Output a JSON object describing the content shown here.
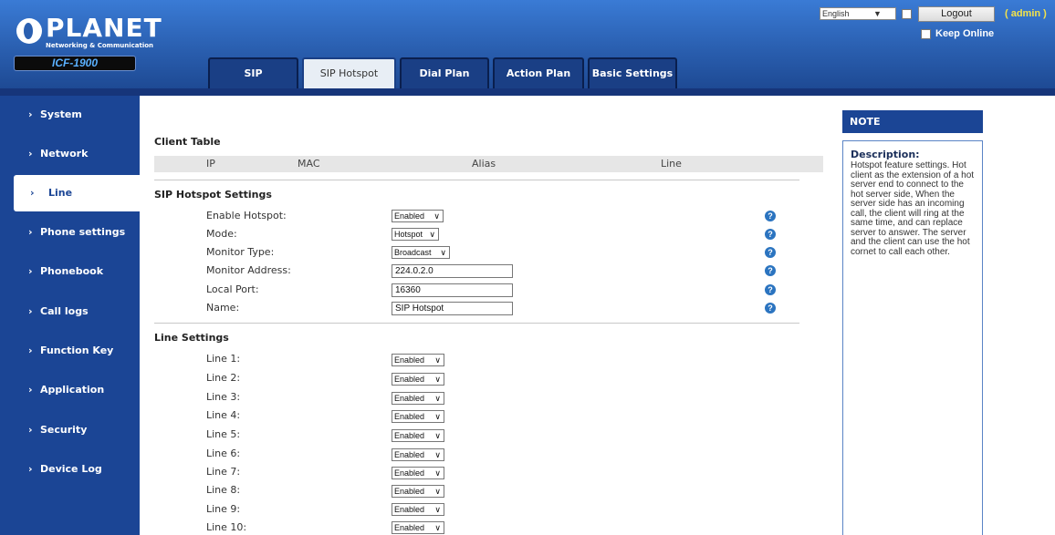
{
  "header": {
    "brand": "PLANET",
    "brand_sub": "Networking & Communication",
    "model": "ICF-1900",
    "language": "English",
    "logout_label": "Logout",
    "user_label": "( admin )",
    "keep_online_label": "Keep Online"
  },
  "tabs": [
    {
      "label": "SIP",
      "active": false
    },
    {
      "label": "SIP Hotspot",
      "active": true
    },
    {
      "label": "Dial Plan",
      "active": false
    },
    {
      "label": "Action Plan",
      "active": false
    },
    {
      "label": "Basic Settings",
      "active": false
    }
  ],
  "sidebar": {
    "items": [
      {
        "label": "System"
      },
      {
        "label": "Network"
      },
      {
        "label": "Line",
        "active": true
      },
      {
        "label": "Phone settings"
      },
      {
        "label": "Phonebook"
      },
      {
        "label": "Call logs"
      },
      {
        "label": "Function Key"
      },
      {
        "label": "Application"
      },
      {
        "label": "Security"
      },
      {
        "label": "Device Log"
      }
    ]
  },
  "client_table": {
    "title": "Client Table",
    "columns": [
      "IP",
      "MAC",
      "Alias",
      "Line"
    ]
  },
  "hotspot": {
    "title": "SIP Hotspot Settings",
    "fields": [
      {
        "label": "Enable Hotspot:",
        "type": "select",
        "value": "Enabled"
      },
      {
        "label": "Mode:",
        "type": "select",
        "value": "Hotspot"
      },
      {
        "label": "Monitor Type:",
        "type": "select",
        "value": "Broadcast"
      },
      {
        "label": "Monitor Address:",
        "type": "text",
        "value": "224.0.2.0"
      },
      {
        "label": "Local Port:",
        "type": "text",
        "value": "16360"
      },
      {
        "label": "Name:",
        "type": "text",
        "value": "SIP Hotspot"
      }
    ],
    "help_glyph": "?"
  },
  "line_settings": {
    "title": "Line Settings",
    "lines": [
      {
        "label": "Line 1:",
        "value": "Enabled"
      },
      {
        "label": "Line 2:",
        "value": "Enabled"
      },
      {
        "label": "Line 3:",
        "value": "Enabled"
      },
      {
        "label": "Line 4:",
        "value": "Enabled"
      },
      {
        "label": "Line 5:",
        "value": "Enabled"
      },
      {
        "label": "Line 6:",
        "value": "Enabled"
      },
      {
        "label": "Line 7:",
        "value": "Enabled"
      },
      {
        "label": "Line 8:",
        "value": "Enabled"
      },
      {
        "label": "Line 9:",
        "value": "Enabled"
      },
      {
        "label": "Line 10:",
        "value": "Enabled"
      }
    ]
  },
  "note": {
    "heading": "NOTE",
    "title": "Description:",
    "text": "Hotspot feature settings. Hot client as the extension of a hot server end to connect to the hot server side, When the server side has an incoming call, the client will ring at the same time, and can replace server to answer. The server and the client can use the hot cornet to call each other."
  },
  "colors": {
    "header_blue": "#2a5fb0",
    "sidebar_blue": "#1b4595",
    "admin_yellow": "#f2e24b",
    "help_blue": "#2b74c0"
  }
}
